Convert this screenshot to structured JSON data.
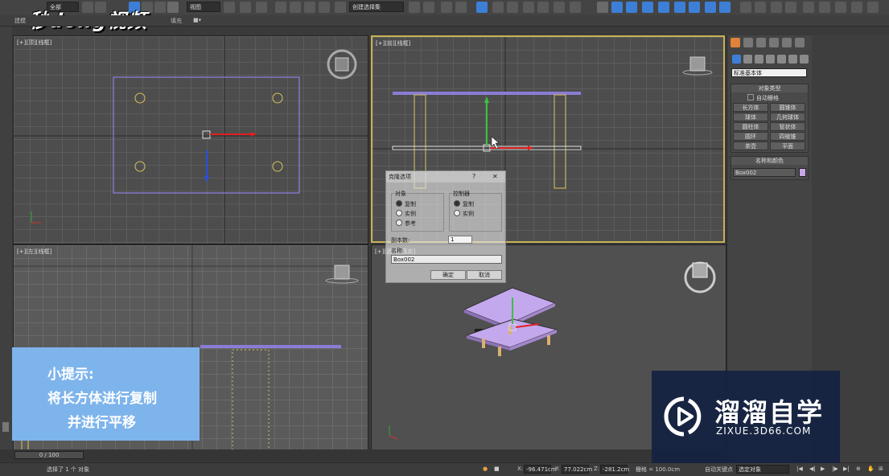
{
  "toolbar": {
    "selection_filter": "全部",
    "ref_coord": "视图",
    "named_selection": "创建选择集"
  },
  "ribbon": {
    "tab_modeling": "建模",
    "tab_populate": "填充"
  },
  "watermark": {
    "top_logo": "秒dong视频"
  },
  "viewports": {
    "top_label": "[+][顶][线框]",
    "front_label": "[+][前][线框]",
    "left_label": "[+][左][线框]",
    "persp_label": "[+][透视][真实]"
  },
  "command_panel": {
    "category_dropdown": "标准基本体",
    "object_type_title": "对象类型",
    "autogrid_label": "自动栅格",
    "object_buttons": [
      "长方体",
      "圆锥体",
      "球体",
      "几何球体",
      "圆柱体",
      "管状体",
      "圆环",
      "四棱锥",
      "茶壶",
      "平面"
    ],
    "name_color_title": "名称和颜色",
    "object_name": "Box002",
    "object_color": "#c9a6e8"
  },
  "clone_dialog": {
    "title": "克隆选项",
    "help": "?",
    "close": "✕",
    "object_group": "对象",
    "object_options": [
      "复制",
      "实例",
      "参考"
    ],
    "object_selected": 0,
    "controller_group": "控制器",
    "controller_options": [
      "复制",
      "实例"
    ],
    "controller_selected": 0,
    "copies_label": "副本数:",
    "copies_value": "1",
    "name_label": "名称:",
    "name_value": "Box002",
    "ok_label": "确定",
    "cancel_label": "取消"
  },
  "tip": {
    "line1": "小提示:",
    "line2": "将长方体进行复制",
    "line3": "并进行平移"
  },
  "brand": {
    "name": "溜溜自学",
    "url": "ZIXUE.3D66.COM"
  },
  "timeline": {
    "frame": "0 / 100"
  },
  "status": {
    "message": "选择了 1 个 对象",
    "x_label": "X:",
    "x_value": "-96.471cm",
    "y_label": "Y:",
    "y_value": "77.022cm",
    "z_label": "Z:",
    "z_value": "-281.2cm",
    "grid_label": "栅格 = 100.0cm",
    "autokey_label": "自动关键点",
    "selected_object": "选定对象"
  },
  "colors": {
    "tip_bg": "#7eb4ec",
    "brand_bg": "#142242",
    "selection_purple": "#8a7cd6",
    "wire_yellow": "#d8c35a",
    "active_border": "#c9b157"
  }
}
